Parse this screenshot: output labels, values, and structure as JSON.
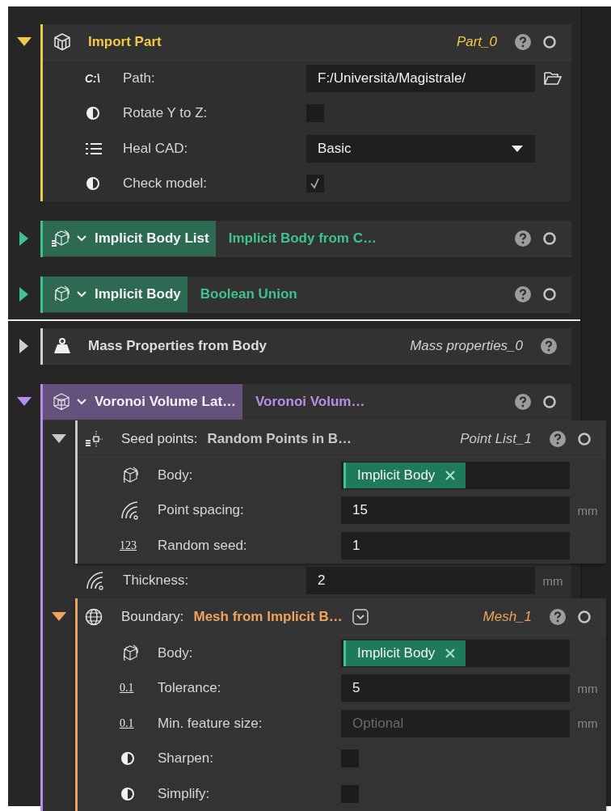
{
  "blocks": [
    {
      "kind": "import",
      "color": "#f2c84b",
      "expanded": true,
      "title": "Import Part",
      "name": "Part_0",
      "output": true,
      "items": [
        {
          "kind": "path",
          "badge": "C:\\",
          "label": "Path:",
          "value": "F:/Università/Magistrale/"
        },
        {
          "kind": "checkbox",
          "label": "Rotate Y to Z:",
          "checked": false
        },
        {
          "kind": "dropdown",
          "label": "Heal CAD:",
          "value": "Basic"
        },
        {
          "kind": "checkbox",
          "label": "Check model:",
          "checked": true
        }
      ]
    },
    {
      "kind": "body_list",
      "color": "#3fc28d",
      "expanded": false,
      "title": "Implicit Body List",
      "subtitle": "Implicit Body from C…",
      "output": true
    },
    {
      "kind": "body",
      "color": "#3fc28d",
      "expanded": false,
      "title": "Implicit Body",
      "subtitle": "Boolean Union",
      "output": true
    },
    {
      "kind": "mass",
      "color": "#d0d0d0",
      "expanded": false,
      "divider_before": true,
      "title": "Mass Properties from Body",
      "name": "Mass properties_0",
      "output": false
    },
    {
      "kind": "lattice",
      "color": "#b78fe6",
      "expanded": true,
      "title": "Voronoi Volume Lat…",
      "subtitle": "Voronoi Volum…",
      "output": true,
      "items": [
        {
          "kind": "points",
          "color": "#c8c8c8",
          "expanded": true,
          "label": "Seed points:",
          "title": "Random Points in B…",
          "name": "Point List_1",
          "output": true,
          "items": [
            {
              "kind": "body_ref",
              "label": "Body:",
              "value": "Implicit Body"
            },
            {
              "kind": "distance",
              "label": "Point spacing:",
              "value": "15",
              "unit": "mm"
            },
            {
              "kind": "integer",
              "badge": "123",
              "label": "Random seed:",
              "value": "1"
            }
          ]
        },
        {
          "kind": "distance",
          "label": "Thickness:",
          "value": "2",
          "unit": "mm"
        },
        {
          "kind": "mesh",
          "color": "#f0a35c",
          "expanded": true,
          "label": "Boundary:",
          "title": "Mesh from Implicit B…",
          "dropdown": true,
          "name": "Mesh_1",
          "output": true,
          "items": [
            {
              "kind": "body_ref",
              "label": "Body:",
              "value": "Implicit Body"
            },
            {
              "kind": "decimal",
              "badge": "0.1",
              "label": "Tolerance:",
              "value": "5",
              "unit": "mm"
            },
            {
              "kind": "decimal",
              "badge": "0.1",
              "label": "Min. feature size:",
              "placeholder": "Optional",
              "unit": "mm"
            },
            {
              "kind": "checkbox",
              "label": "Sharpen:",
              "checked": false
            },
            {
              "kind": "checkbox",
              "label": "Simplify:",
              "checked": false
            }
          ]
        }
      ]
    }
  ]
}
